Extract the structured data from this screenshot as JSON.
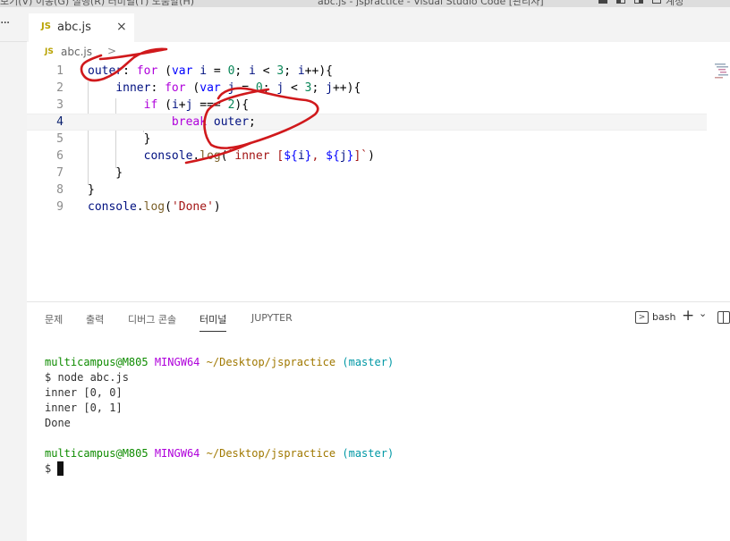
{
  "titlebar": {
    "menu_text": "보기(V)   이동(G)   실행(R)   터미널(T)   도움말(H)",
    "window_title": "abc.js - jspractice - Visual Studio Code [관리자]",
    "account": "계정"
  },
  "activity": {
    "more": "···"
  },
  "tab": {
    "badge": "JS",
    "name": "abc.js",
    "close": "×"
  },
  "breadcrumb": {
    "badge": "JS",
    "file": "abc.js",
    "chevron": ">"
  },
  "editor": {
    "line_numbers": [
      "1",
      "2",
      "3",
      "4",
      "5",
      "6",
      "7",
      "8",
      "9"
    ],
    "active_line": 4
  },
  "panel": {
    "tabs": [
      "문제",
      "출력",
      "디버그 콘솔",
      "터미널",
      "JUPYTER"
    ],
    "active_tab": "터미널",
    "shell": "bash",
    "add": "+",
    "dropdown": "⌄",
    "shell_icon": ">"
  },
  "terminal": {
    "prompt1": {
      "user": "multicampus@M805",
      "system": "MINGW64",
      "path": "~/Desktop/jspractice",
      "branch": "(master)"
    },
    "command": "$ node abc.js",
    "output": [
      "inner [0, 0]",
      "inner [0, 1]",
      "Done"
    ],
    "prompt2": {
      "user": "multicampus@M805",
      "system": "MINGW64",
      "path": "~/Desktop/jspractice",
      "branch": "(master)"
    },
    "input_prompt": "$"
  },
  "colors": {
    "keyword": "#0000ff",
    "control": "#af00db",
    "number": "#098658",
    "string": "#a31515",
    "annotation": "#d0191c"
  }
}
